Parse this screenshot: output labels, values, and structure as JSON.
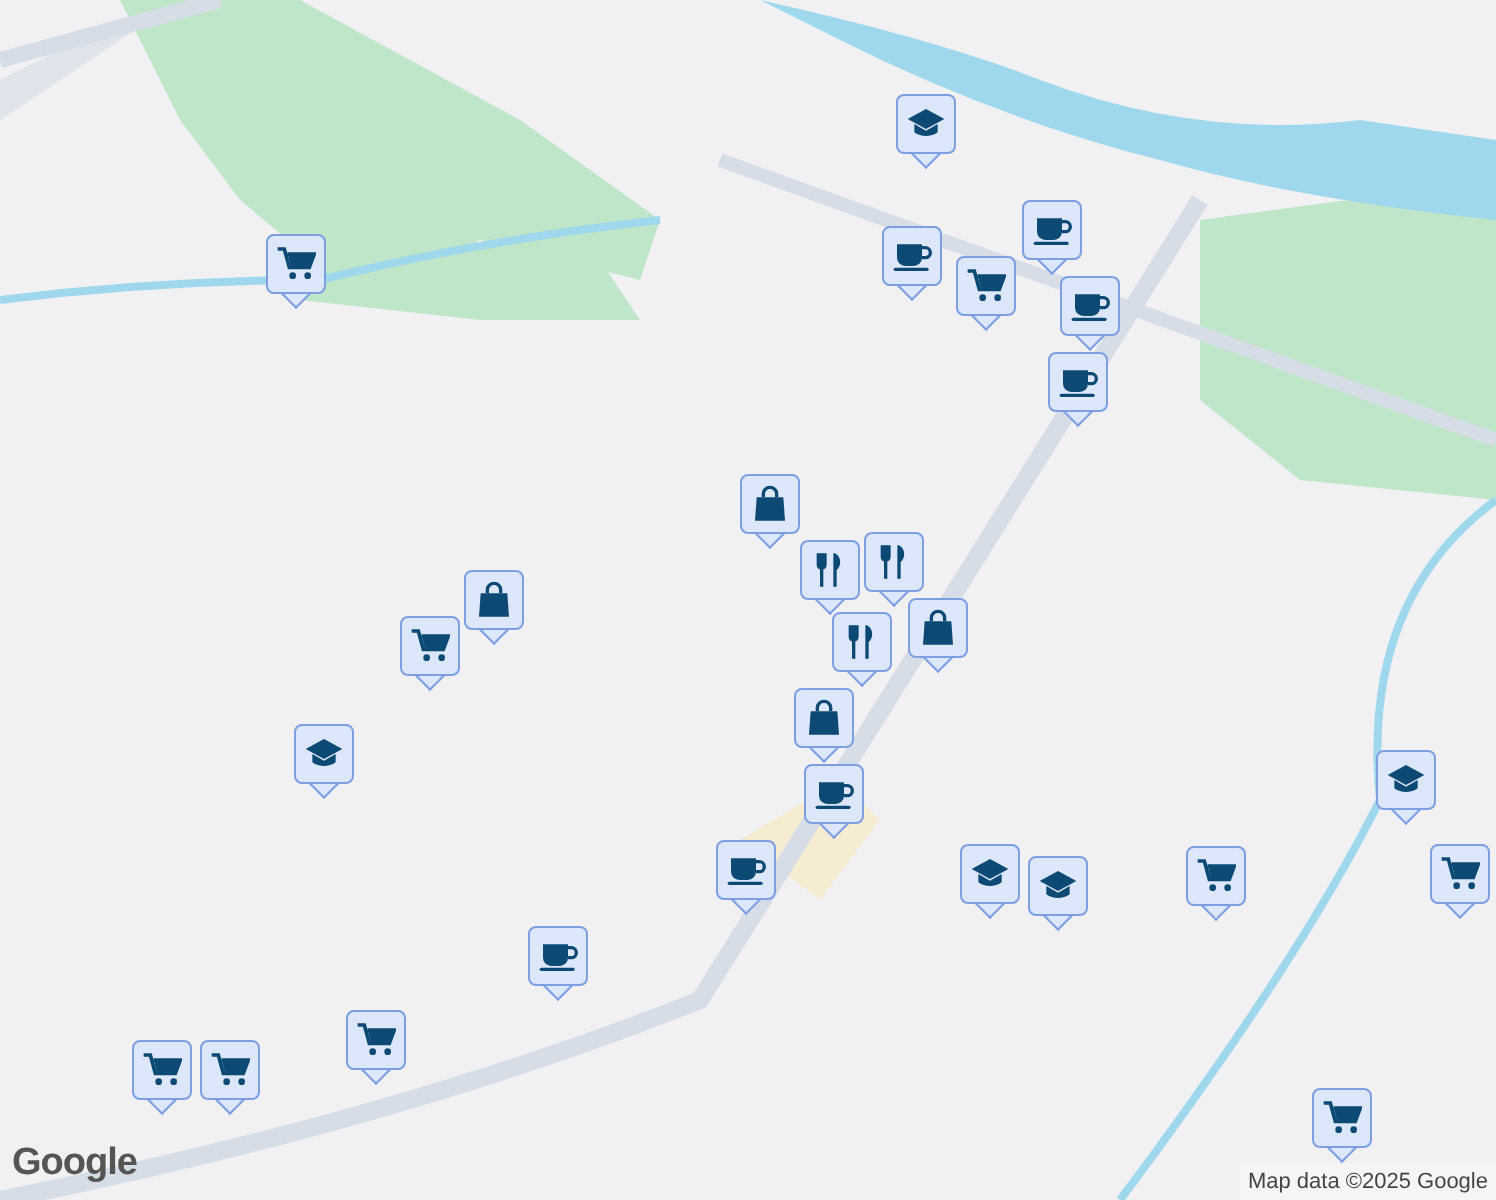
{
  "map": {
    "markers": [
      {
        "kind": "school"
      },
      {
        "kind": "cart"
      },
      {
        "kind": "cup"
      },
      {
        "kind": "cup"
      },
      {
        "kind": "cart"
      },
      {
        "kind": "cup"
      },
      {
        "kind": "cup"
      },
      {
        "kind": "bag"
      },
      {
        "kind": "fork"
      },
      {
        "kind": "fork"
      },
      {
        "kind": "fork"
      },
      {
        "kind": "bag"
      },
      {
        "kind": "bag"
      },
      {
        "kind": "cart"
      },
      {
        "kind": "bag"
      },
      {
        "kind": "cup"
      },
      {
        "kind": "school"
      },
      {
        "kind": "cup"
      },
      {
        "kind": "school"
      },
      {
        "kind": "school"
      },
      {
        "kind": "cart"
      },
      {
        "kind": "school"
      },
      {
        "kind": "cart"
      },
      {
        "kind": "cup"
      },
      {
        "kind": "cart"
      },
      {
        "kind": "cart"
      },
      {
        "kind": "cart"
      },
      {
        "kind": "cart"
      }
    ]
  },
  "logo": "Google",
  "attribution": "Map data ©2025 Google"
}
